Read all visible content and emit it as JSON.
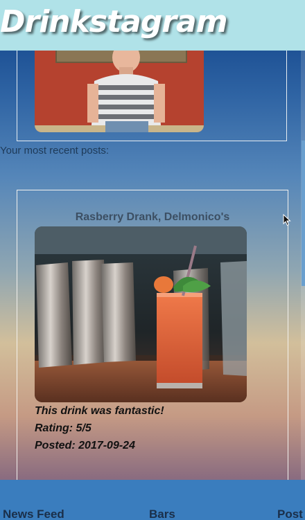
{
  "header": {
    "title": "Drinkstagram"
  },
  "profile": {
    "photo_icon": "profile-photo"
  },
  "recent_label": "Your most recent posts:",
  "post": {
    "title": "Rasberry Drank, Delmonico's",
    "description": "This drink was fantastic!",
    "rating": "Rating: 5/5",
    "posted": "Posted: 2017-09-24"
  },
  "nav": {
    "items": [
      {
        "label": "News Feed"
      },
      {
        "label": "Bars"
      },
      {
        "label": "Post"
      }
    ]
  },
  "colors": {
    "header_bg": "#b0e2e8",
    "nav_bg": "#3a7dbe"
  }
}
